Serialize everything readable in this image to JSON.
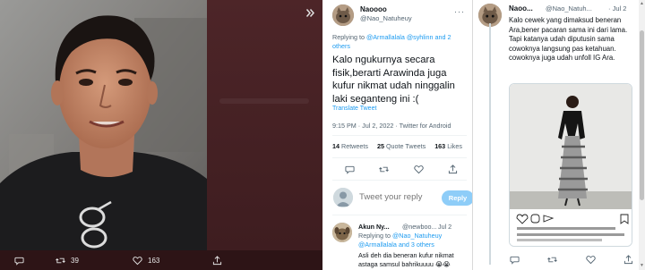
{
  "viewer": {
    "reply_count": "",
    "retweet_count": "39",
    "like_count": "163"
  },
  "tweet": {
    "author_name": "Naoooo",
    "author_handle": "@Nao_Natuheuy",
    "replying_prefix": "Replying to",
    "replying_mentions": "@Armallalala @syhlinn and 2 others",
    "text": "Kalo ngukurnya secara fisik,berarti Arawinda juga kufur nikmat udah ninggalin laki seganteng ini :(",
    "translate_label": "Translate Tweet",
    "timestamp": "9:15 PM · Jul 2, 2022 · Twitter for Android",
    "retweets_count": "14",
    "retweets_label": "Retweets",
    "quote_count": "25",
    "quote_label": "Quote Tweets",
    "likes_count": "163",
    "likes_label": "Likes"
  },
  "compose": {
    "placeholder": "Tweet your reply",
    "reply_button": "Reply"
  },
  "reply_tweet": {
    "author_name": "Akun Ny...",
    "author_handle": "@newboo...",
    "time": "Jul 2",
    "replying_prefix": "Replying to",
    "replying_mentions": "@Nao_Natuheuy @Armallalala and 3 others",
    "text": "Asli deh dia beneran kufur nikmat astaga samsul bahrikuuuu 😭😭"
  },
  "right_tweet": {
    "author_name": "Naoo...",
    "author_handle": "@Nao_Natuh...",
    "time": "· Jul 2",
    "line1": "Kalo cewek yang dimaksud beneran Ara,bener pacaran sama ini dari lama.",
    "line2": "Tapi katanya udah diputusin sama cowoknya langsung pas ketahuan.",
    "line3": "cowoknya juga udah unfoll IG Ara."
  },
  "colors": {
    "accent": "#1d9bf0",
    "viewer_bg": "#4a2224",
    "muted_text": "#536471"
  }
}
